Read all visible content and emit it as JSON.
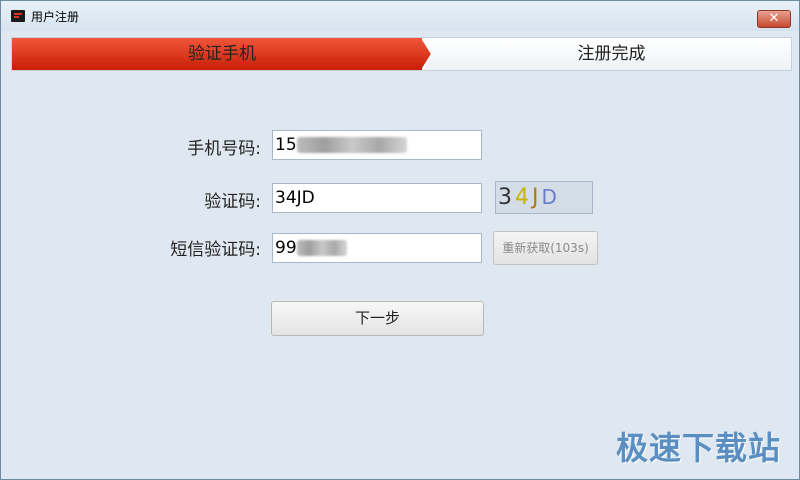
{
  "window": {
    "title": "用户注册",
    "close_glyph": "✕"
  },
  "steps": [
    {
      "label": "验证手机",
      "active": true
    },
    {
      "label": "注册完成",
      "active": false
    }
  ],
  "form": {
    "phone_label": "手机号码:",
    "phone_value": "15",
    "captcha_label": "验证码:",
    "captcha_value": "34JD",
    "captcha_chars": [
      {
        "ch": "3",
        "color": "#333333"
      },
      {
        "ch": "4",
        "color": "#c8b400"
      },
      {
        "ch": "J",
        "color": "#b07a10"
      },
      {
        "ch": "D",
        "color": "#6a7fc8"
      }
    ],
    "sms_label": "短信验证码:",
    "sms_value": "99",
    "resend_label": "重新获取(103s)",
    "next_label": "下一步"
  },
  "watermark": "极速下载站"
}
